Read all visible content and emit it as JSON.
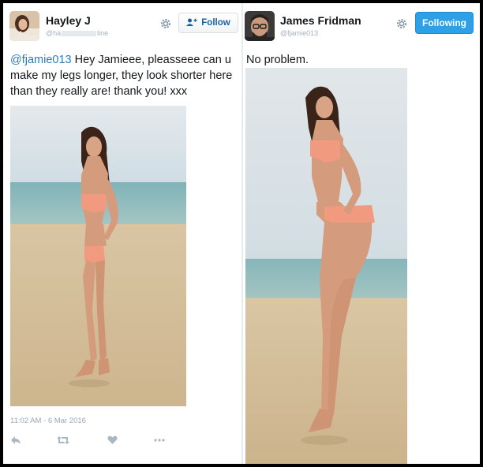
{
  "left_tweet": {
    "display_name": "Hayley J",
    "handle": "@ha",
    "handle_suffix": "line",
    "follow_label": "Follow",
    "mention": "@fjamie013",
    "text": " Hey Jamieee, pleasseee can u make my legs longer, they look shorter here than they really are! thank you! xxx",
    "timestamp": "11:02 AM - 6 Mar 2016",
    "icons": {
      "avatar": "avatar",
      "settings": "gear-icon",
      "follow": "add-person-icon",
      "reply": "reply-icon",
      "retweet": "retweet-icon",
      "like": "heart-icon",
      "more": "more-icon"
    }
  },
  "right_tweet": {
    "display_name": "James Fridman",
    "handle": "@fjamie013",
    "following_label": "Following",
    "text": "No problem.",
    "icons": {
      "avatar": "avatar",
      "settings": "gear-icon"
    }
  },
  "colors": {
    "link": "#2b7bb9",
    "following_bg": "#2fa0e6",
    "text": "#14171a",
    "muted": "#9aa8b3"
  }
}
